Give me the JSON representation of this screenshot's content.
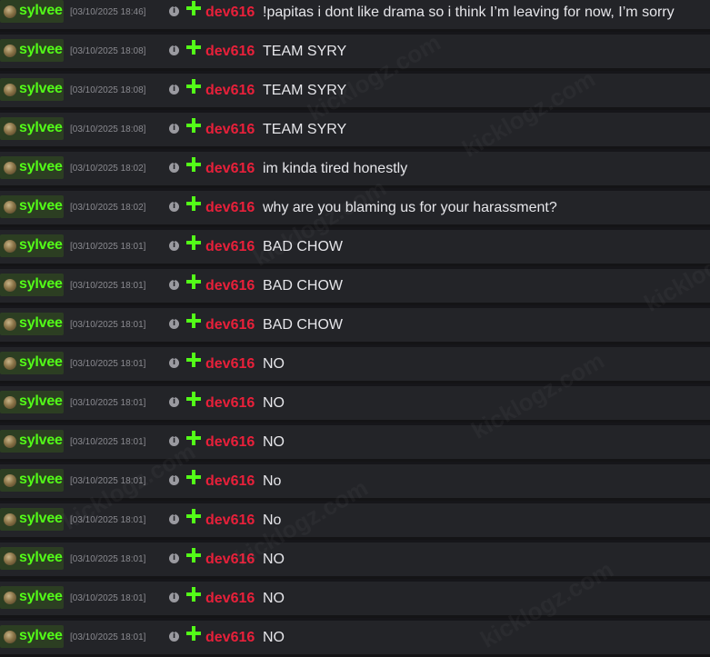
{
  "colors": {
    "channel": "#53fc18",
    "user": "#e8203a",
    "message": "#e6e6ea",
    "timestamp": "#8a8a90",
    "row_bg": "#232428"
  },
  "icons": {
    "channel_avatar": "avatar-icon",
    "info": "info-icon",
    "badge": "green-star-badge-icon"
  },
  "info_glyph": "i",
  "watermark": "kicklogz.com",
  "rows": [
    {
      "channel": "sylvee",
      "timestamp": "[03/10/2025 18:46]",
      "user": "dev616",
      "message": "!papitas i dont like drama so i think I’m leaving for now, I’m sorry"
    },
    {
      "channel": "sylvee",
      "timestamp": "[03/10/2025 18:08]",
      "user": "dev616",
      "message": "TEAM SYRY"
    },
    {
      "channel": "sylvee",
      "timestamp": "[03/10/2025 18:08]",
      "user": "dev616",
      "message": "TEAM SYRY"
    },
    {
      "channel": "sylvee",
      "timestamp": "[03/10/2025 18:08]",
      "user": "dev616",
      "message": "TEAM SYRY"
    },
    {
      "channel": "sylvee",
      "timestamp": "[03/10/2025 18:02]",
      "user": "dev616",
      "message": "im kinda tired honestly"
    },
    {
      "channel": "sylvee",
      "timestamp": "[03/10/2025 18:02]",
      "user": "dev616",
      "message": "why are you blaming us for your harassment?"
    },
    {
      "channel": "sylvee",
      "timestamp": "[03/10/2025 18:01]",
      "user": "dev616",
      "message": "BAD CHOW"
    },
    {
      "channel": "sylvee",
      "timestamp": "[03/10/2025 18:01]",
      "user": "dev616",
      "message": "BAD CHOW"
    },
    {
      "channel": "sylvee",
      "timestamp": "[03/10/2025 18:01]",
      "user": "dev616",
      "message": "BAD CHOW"
    },
    {
      "channel": "sylvee",
      "timestamp": "[03/10/2025 18:01]",
      "user": "dev616",
      "message": "NO"
    },
    {
      "channel": "sylvee",
      "timestamp": "[03/10/2025 18:01]",
      "user": "dev616",
      "message": "NO"
    },
    {
      "channel": "sylvee",
      "timestamp": "[03/10/2025 18:01]",
      "user": "dev616",
      "message": "NO"
    },
    {
      "channel": "sylvee",
      "timestamp": "[03/10/2025 18:01]",
      "user": "dev616",
      "message": "No"
    },
    {
      "channel": "sylvee",
      "timestamp": "[03/10/2025 18:01]",
      "user": "dev616",
      "message": "No"
    },
    {
      "channel": "sylvee",
      "timestamp": "[03/10/2025 18:01]",
      "user": "dev616",
      "message": "NO"
    },
    {
      "channel": "sylvee",
      "timestamp": "[03/10/2025 18:01]",
      "user": "dev616",
      "message": "NO"
    },
    {
      "channel": "sylvee",
      "timestamp": "[03/10/2025 18:01]",
      "user": "dev616",
      "message": "NO"
    }
  ]
}
